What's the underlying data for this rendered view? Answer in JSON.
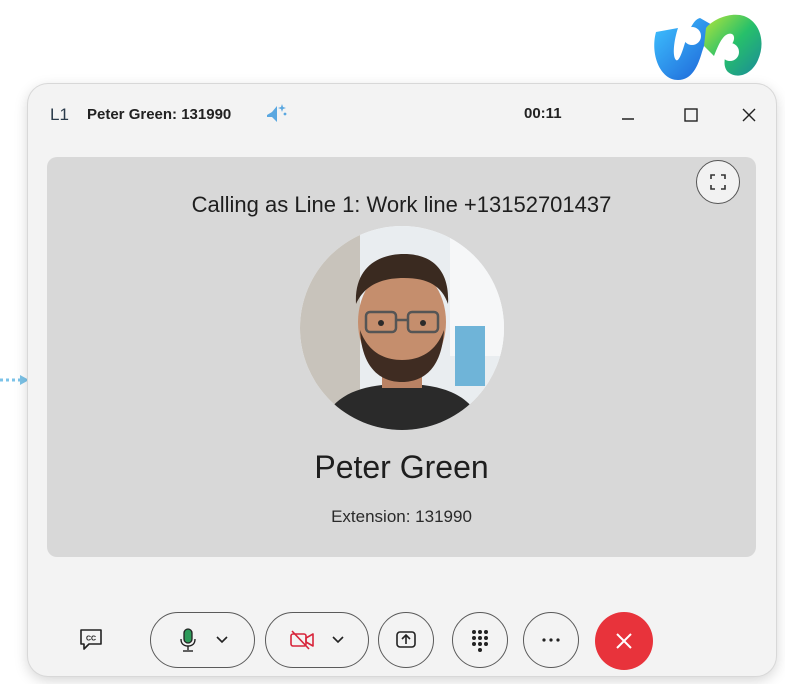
{
  "colors": {
    "window_bg": "#f3f3f3",
    "stage_bg": "#d8d8d8",
    "end_call_red": "#e8333b",
    "mic_green": "#2e9b5a",
    "video_off_red": "#d8243a",
    "sparkle_blue": "#5aa7e0"
  },
  "titlebar": {
    "line_tag": "L1",
    "call_title": "Peter Green: 131990",
    "timer": "00:11",
    "icons": {
      "sparkle": "ai-sparkle-icon",
      "minimize": "minimize-icon",
      "maximize": "maximize-icon",
      "close": "close-icon"
    }
  },
  "stage": {
    "calling_as": "Calling as Line 1: Work line +13152701437",
    "contact_name": "Peter Green",
    "extension": "Extension: 131990",
    "fullscreen_icon": "fullscreen-icon"
  },
  "controls": {
    "captions_icon": "closed-captions-icon",
    "mic_icon": "microphone-icon",
    "video_icon": "video-off-icon",
    "share_icon": "share-screen-icon",
    "keypad_icon": "keypad-icon",
    "more_icon": "more-options-icon",
    "end_icon": "end-call-icon"
  }
}
